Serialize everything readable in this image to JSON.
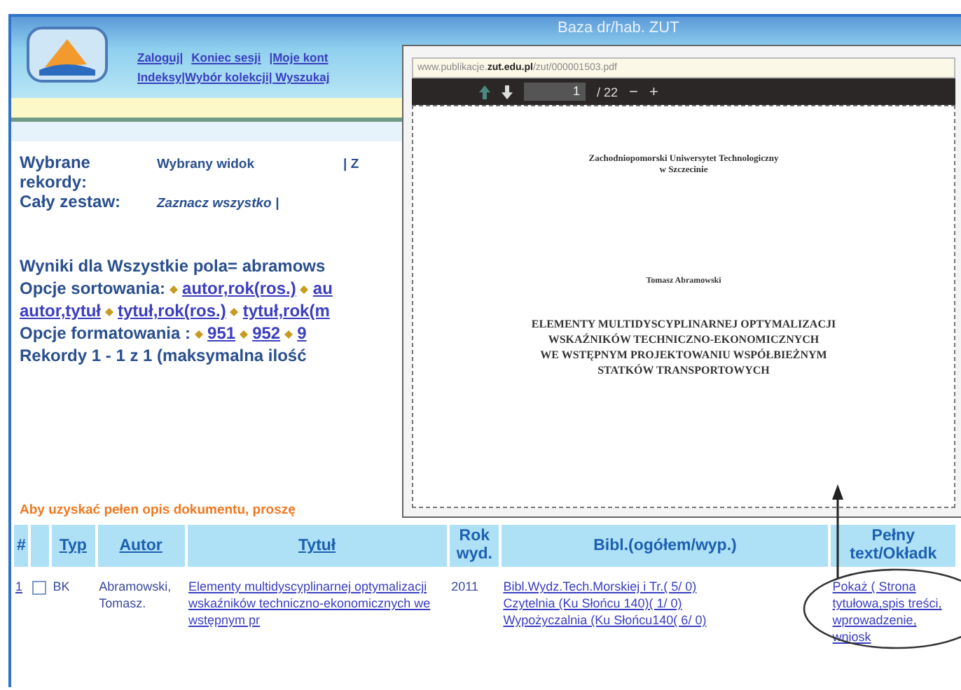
{
  "window": {
    "title": "Baza dr/hab. ZUT"
  },
  "nav": {
    "row1": [
      "Zaloguj|",
      "Koniec sesji",
      "|Moje kont"
    ],
    "row2": [
      "Indeksy|Wybór kolekcji| Wyszukaj"
    ]
  },
  "selection": [
    {
      "label": "Wybrane rekordy:",
      "links": [
        "Wybrany widok",
        "| Z"
      ]
    },
    {
      "label": "Cały zestaw:",
      "links": [
        "Zaznacz wszystko |"
      ]
    }
  ],
  "results_heading": "Wyniki dla Wszystkie pola= abramows",
  "sort_options": {
    "label": "Opcje sortowania:",
    "links": [
      "autor,rok(ros.)",
      "au",
      "autor,tytuł",
      "tytuł,rok(ros.)",
      "tytuł,rok(m"
    ]
  },
  "format_options": {
    "label": "Opcje formatowania :",
    "links": [
      "951",
      "952",
      "9"
    ]
  },
  "record_count": "Rekordy 1 - 1 z 1 (maksymalna ilość",
  "hint": "Aby uzyskać pełen opis dokumentu, proszę",
  "table": {
    "columns": [
      "#",
      "Typ",
      "Autor",
      "Tytuł",
      "Rok wyd.",
      "Bibl.(ogółem/wyp.)",
      "Pełny text/Okładk"
    ],
    "rows": [
      {
        "number": "1",
        "checked": false,
        "type": "BK",
        "author": "Abramowski, Tomasz.",
        "title": "Elementy multidyscyplinarnej optymalizacji wskaźników techniczno-ekonomicznych we wstępnym pr",
        "year": "2011",
        "holdings": [
          "Bibl.Wydz.Tech.Morskiej i Tr.( 5/ 0)",
          "Czytelnia (Ku Słońcu 140)( 1/ 0)",
          "Wypożyczalnia (Ku Słońcu140( 6/ 0)"
        ],
        "full_text": "Pokaż ( Strona tytułowa,spis treści, wprowadzenie, wniosk"
      }
    ]
  },
  "pdf_viewer": {
    "address": "www.publikacje.**zut.edu.pl**/zut/000001503.pdf",
    "page": "1",
    "page_count": "/ 22",
    "zoom_out": "−",
    "zoom_in": "+",
    "document": {
      "institution": [
        "Zachodniopomorski Uniwersytet Technologiczny",
        "w Szczecinie"
      ],
      "author": "Tomasz Abramowski",
      "title": [
        "ELEMENTY MULTIDYSCYPLINARNEJ OPTYMALIZACJI",
        "WSKAŹNIKÓW TECHNICZNO-EKONOMICZNYCH",
        "WE WSTĘPNYM PROJEKTOWANIU WSPÓŁBIEŻNYM",
        "STATKÓW TRANSPORTOWYCH"
      ]
    }
  }
}
